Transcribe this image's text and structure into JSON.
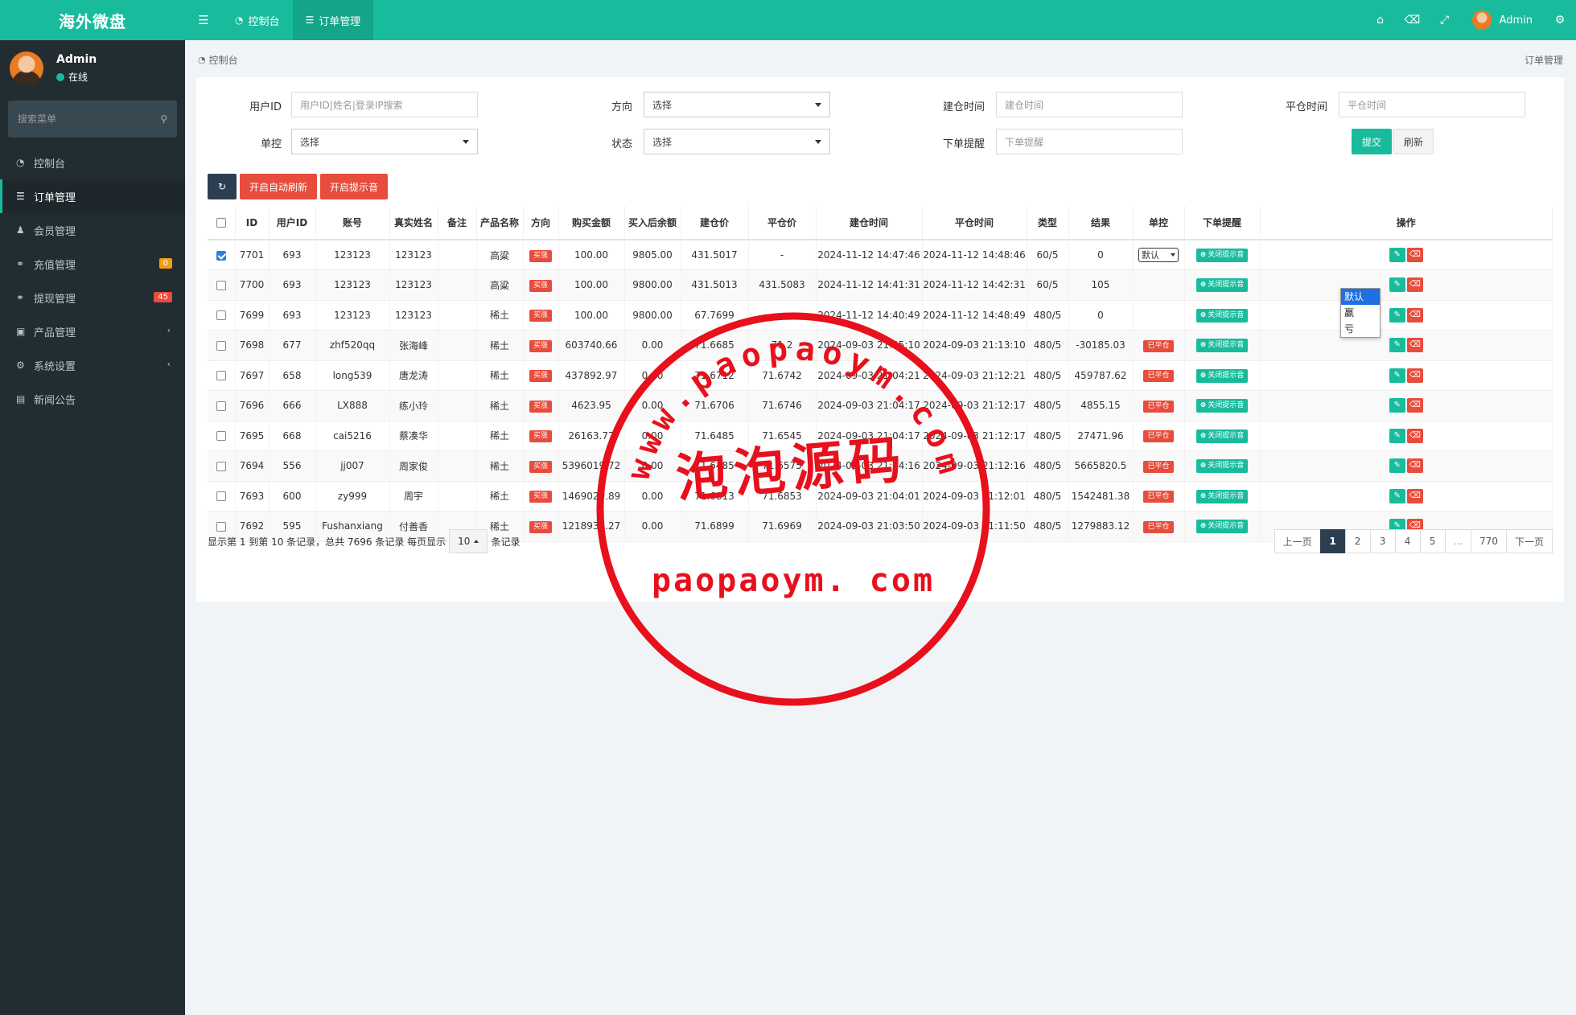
{
  "sidebar": {
    "logo": "海外微盘",
    "user": {
      "name": "Admin",
      "status": "在线"
    },
    "search_placeholder": "搜索菜单",
    "items": [
      {
        "label": "控制台",
        "icon": "dashboard-icon"
      },
      {
        "label": "订单管理",
        "icon": "list-icon",
        "active": true
      },
      {
        "label": "会员管理",
        "icon": "users-icon"
      },
      {
        "label": "充值管理",
        "icon": "recharge-icon",
        "badge": "0"
      },
      {
        "label": "提现管理",
        "icon": "withdraw-icon",
        "badge": "45"
      },
      {
        "label": "产品管理",
        "icon": "shopping-bag-icon"
      },
      {
        "label": "系统设置",
        "icon": "cogs-icon"
      },
      {
        "label": "新闻公告",
        "icon": "newspaper-icon"
      }
    ]
  },
  "topbar": {
    "tabs": [
      {
        "label": "控制台"
      },
      {
        "label": "订单管理",
        "active": true
      }
    ],
    "user_name": "Admin"
  },
  "breadcrumb": {
    "home": "控制台",
    "current": "订单管理"
  },
  "filters": {
    "user_id_label": "用户ID",
    "user_id_placeholder": "用户ID|姓名|登录IP搜索",
    "direction_label": "方向",
    "direction_value": "选择",
    "open_time_label": "建仓时间",
    "open_time_placeholder": "建仓时间",
    "close_time_label": "平仓时间",
    "close_time_placeholder": "平仓时间",
    "single_control_label": "单控",
    "single_control_value": "选择",
    "status_label": "状态",
    "status_value": "选择",
    "order_alert_label": "下单提醒",
    "order_alert_placeholder": "下单提醒",
    "submit_label": "提交",
    "reset_label": "刷新"
  },
  "toolbar": {
    "auto_refresh_label": "开启自动刷新",
    "sound_label": "开启提示音"
  },
  "table": {
    "headers": [
      "ID",
      "用户ID",
      "账号",
      "真实姓名",
      "备注",
      "产品名称",
      "方向",
      "购买金额",
      "买入后余额",
      "建仓价",
      "平仓价",
      "建仓时间",
      "平仓时间",
      "类型",
      "结果",
      "单控",
      "下单提醒",
      "操作"
    ],
    "direction_badge": "买涨",
    "closed_badge": "已平仓",
    "alert_button": "关闭提示音",
    "control_select_value": "默认",
    "control_options": [
      "默认",
      "赢",
      "亏"
    ],
    "rows": [
      {
        "checked": true,
        "id": "7701",
        "uid": "693",
        "account": "123123",
        "name": "123123",
        "note": "",
        "product": "高粱",
        "amount": "100.00",
        "balance": "9805.00",
        "open": "431.5017",
        "close": "-",
        "open_time": "2024-11-12 14:47:46",
        "close_time": "2024-11-12 14:48:46",
        "type": "60/5",
        "result": "0",
        "control": "select"
      },
      {
        "checked": false,
        "id": "7700",
        "uid": "693",
        "account": "123123",
        "name": "123123",
        "note": "",
        "product": "高粱",
        "amount": "100.00",
        "balance": "9800.00",
        "open": "431.5013",
        "close": "431.5083",
        "open_time": "2024-11-12 14:41:31",
        "close_time": "2024-11-12 14:42:31",
        "type": "60/5",
        "result": "105",
        "control": "none"
      },
      {
        "checked": false,
        "id": "7699",
        "uid": "693",
        "account": "123123",
        "name": "123123",
        "note": "",
        "product": "稀土",
        "amount": "100.00",
        "balance": "9800.00",
        "open": "67.7699",
        "close": "-",
        "open_time": "2024-11-12 14:40:49",
        "close_time": "2024-11-12 14:48:49",
        "type": "480/5",
        "result": "0",
        "control": "none"
      },
      {
        "checked": false,
        "id": "7698",
        "uid": "677",
        "account": "zhf520qq",
        "name": "张海峰",
        "note": "",
        "product": "稀土",
        "amount": "603740.66",
        "balance": "0.00",
        "open": "71.6685",
        "close": "71.2",
        "open_time": "2024-09-03 21:05:10",
        "close_time": "2024-09-03 21:13:10",
        "type": "480/5",
        "result": "-30185.03",
        "control": "closed"
      },
      {
        "checked": false,
        "id": "7697",
        "uid": "658",
        "account": "long539",
        "name": "唐龙涛",
        "note": "",
        "product": "稀土",
        "amount": "437892.97",
        "balance": "0.00",
        "open": "71.6712",
        "close": "71.6742",
        "open_time": "2024-09-03 21:04:21",
        "close_time": "2024-09-03 21:12:21",
        "type": "480/5",
        "result": "459787.62",
        "control": "closed"
      },
      {
        "checked": false,
        "id": "7696",
        "uid": "666",
        "account": "LX888",
        "name": "练小玲",
        "note": "",
        "product": "稀土",
        "amount": "4623.95",
        "balance": "0.00",
        "open": "71.6706",
        "close": "71.6746",
        "open_time": "2024-09-03 21:04:17",
        "close_time": "2024-09-03 21:12:17",
        "type": "480/5",
        "result": "4855.15",
        "control": "closed"
      },
      {
        "checked": false,
        "id": "7695",
        "uid": "668",
        "account": "cai5216",
        "name": "蔡凑华",
        "note": "",
        "product": "稀土",
        "amount": "26163.77",
        "balance": "0.00",
        "open": "71.6485",
        "close": "71.6545",
        "open_time": "2024-09-03 21:04:17",
        "close_time": "2024-09-03 21:12:17",
        "type": "480/5",
        "result": "27471.96",
        "control": "closed"
      },
      {
        "checked": false,
        "id": "7694",
        "uid": "556",
        "account": "jj007",
        "name": "周家俊",
        "note": "",
        "product": "稀土",
        "amount": "5396019.72",
        "balance": "0.00",
        "open": "71.6485",
        "close": "71.6575",
        "open_time": "2024-09-03 21:04:16",
        "close_time": "2024-09-03 21:12:16",
        "type": "480/5",
        "result": "5665820.5",
        "control": "closed"
      },
      {
        "checked": false,
        "id": "7693",
        "uid": "600",
        "account": "zy999",
        "name": "周宇",
        "note": "",
        "product": "稀土",
        "amount": "1469029.89",
        "balance": "0.00",
        "open": "71.6813",
        "close": "71.6853",
        "open_time": "2024-09-03 21:04:01",
        "close_time": "2024-09-03 21:12:01",
        "type": "480/5",
        "result": "1542481.38",
        "control": "closed"
      },
      {
        "checked": false,
        "id": "7692",
        "uid": "595",
        "account": "Fushanxiang",
        "name": "付善香",
        "note": "",
        "product": "稀土",
        "amount": "1218936.27",
        "balance": "0.00",
        "open": "71.6899",
        "close": "71.6969",
        "open_time": "2024-09-03 21:03:50",
        "close_time": "2024-09-03 21:11:50",
        "type": "480/5",
        "result": "1279883.12",
        "control": "closed"
      }
    ]
  },
  "pager": {
    "info_prefix": "显示第 1 到第 10 条记录，总共 7696 条记录 每页显示",
    "page_size": "10",
    "info_suffix": "条记录",
    "prev": "上一页",
    "next": "下一页",
    "pages": [
      "1",
      "2",
      "3",
      "4",
      "5",
      "...",
      "770"
    ],
    "current": "1"
  },
  "watermark": {
    "ring_text": "www.paopaoym.com",
    "center_text": "泡泡源码",
    "bottom_text": "paopaoym. com",
    "color": "#e8101c"
  },
  "colors": {
    "primary": "#18bc9c",
    "sidebar": "#222d32",
    "danger": "#e74c3c",
    "dark": "#2c3e50"
  }
}
